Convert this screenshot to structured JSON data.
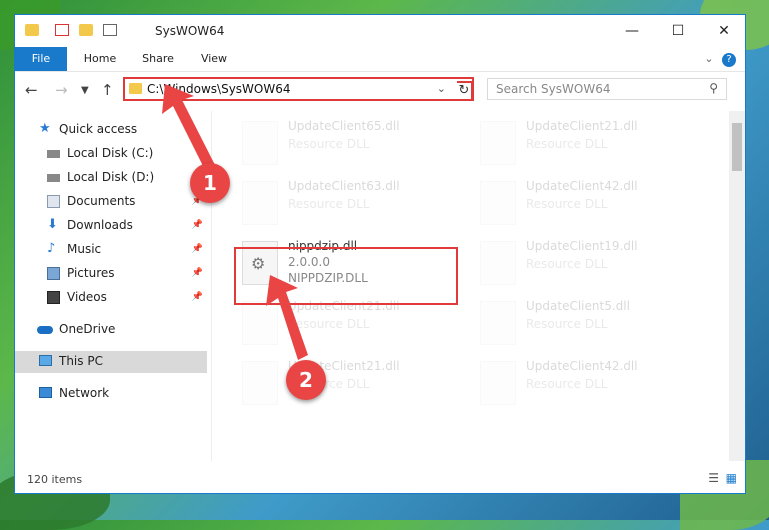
{
  "window": {
    "title": "SysWOW64"
  },
  "ribbon": {
    "tabs": [
      "File",
      "Home",
      "Share",
      "View"
    ]
  },
  "address": {
    "path": "C:\\Windows\\SysWOW64"
  },
  "search": {
    "placeholder": "Search SysWOW64"
  },
  "sidebar": {
    "items": [
      {
        "label": "Quick access",
        "icon": "star-icon"
      },
      {
        "label": "Local Disk (C:)",
        "icon": "drive-icon"
      },
      {
        "label": "Local Disk (D:)",
        "icon": "drive-icon"
      },
      {
        "label": "Documents",
        "icon": "documents-icon"
      },
      {
        "label": "Downloads",
        "icon": "download-icon"
      },
      {
        "label": "Music",
        "icon": "music-icon"
      },
      {
        "label": "Pictures",
        "icon": "pictures-icon"
      },
      {
        "label": "Videos",
        "icon": "videos-icon"
      },
      {
        "label": "OneDrive",
        "icon": "cloud-icon"
      },
      {
        "label": "This PC",
        "icon": "computer-icon"
      },
      {
        "label": "Network",
        "icon": "network-icon"
      }
    ]
  },
  "files": [
    {
      "name": "UpdateClient65.dll",
      "type": "Resource DLL"
    },
    {
      "name": "UpdateClient21.dll",
      "type": "Resource DLL"
    },
    {
      "name": "UpdateClient63.dll",
      "type": "Resource DLL"
    },
    {
      "name": "UpdateClient42.dll",
      "type": "Resource DLL"
    },
    {
      "name": "nippdzip.dll",
      "version": "2.0.0.0",
      "type": "NIPPDZIP.DLL"
    },
    {
      "name": "UpdateClient19.dll",
      "type": "Resource DLL"
    },
    {
      "name": "UpdateClient21.dll",
      "type": "Resource DLL"
    },
    {
      "name": "UpdateClient5.dll",
      "type": "Resource DLL"
    },
    {
      "name": "UpdateClient21.dll",
      "type": "Resource DLL"
    },
    {
      "name": "UpdateClient42.dll",
      "type": "Resource DLL"
    }
  ],
  "callouts": [
    "1",
    "2"
  ],
  "status": {
    "count": "120 items"
  },
  "colors": {
    "accent": "#1979ca",
    "highlight": "#e03a3a",
    "callout": "#e94545"
  }
}
